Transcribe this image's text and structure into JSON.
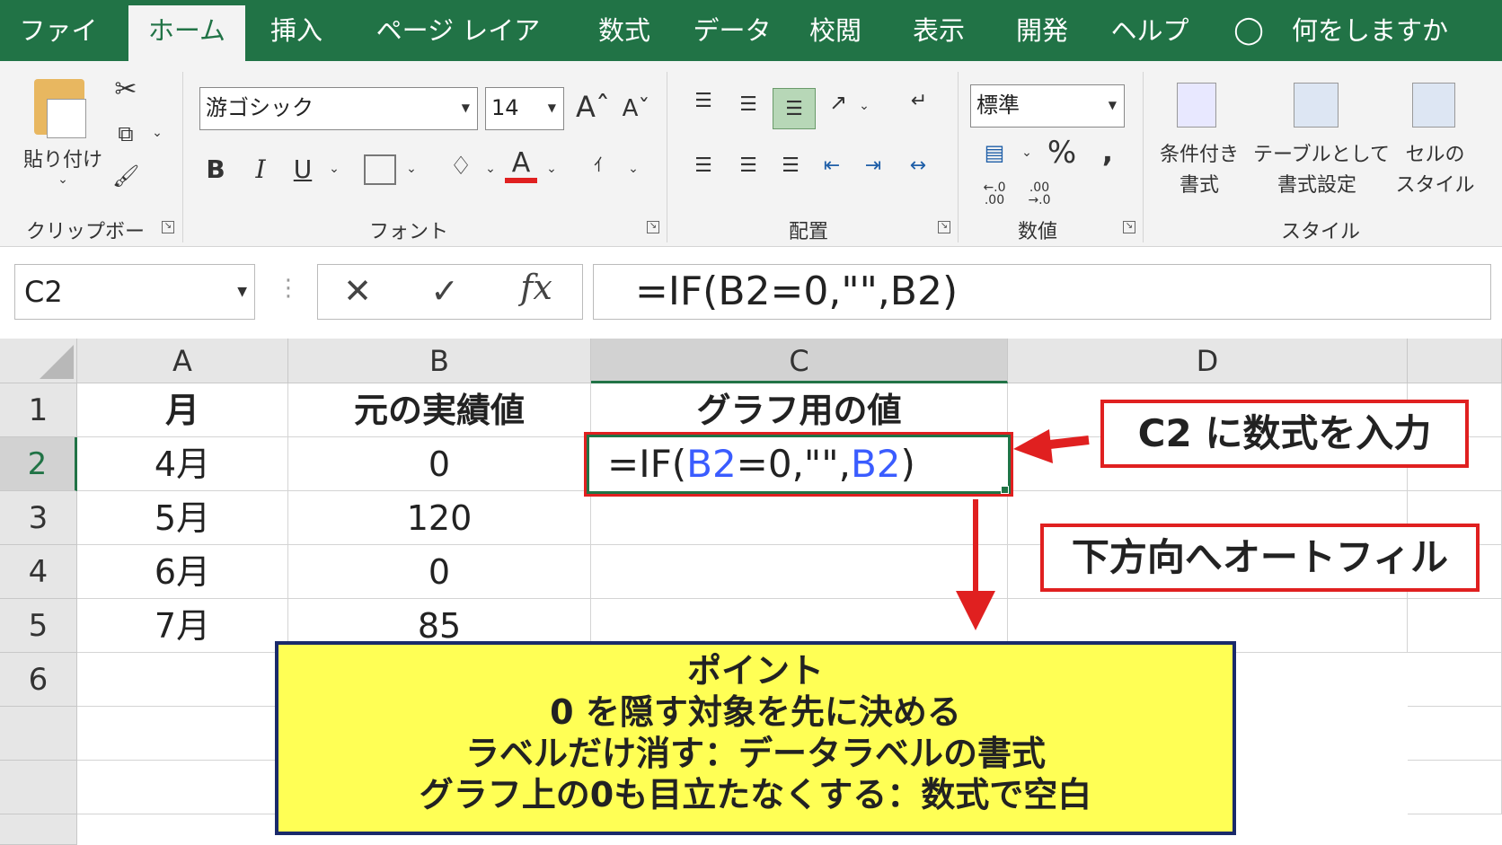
{
  "tabs": [
    "ファイル",
    "ホーム",
    "挿入",
    "ページ レイアウト",
    "数式",
    "データ",
    "校閲",
    "表示",
    "開発",
    "ヘルプ"
  ],
  "tell_me": "何をしますか",
  "clipboard": {
    "paste_label": "貼り付け",
    "group_label": "クリップボード"
  },
  "font": {
    "family": "游ゴシック",
    "size": "14",
    "group_label": "フォント",
    "bold": "B",
    "italic": "I",
    "underline": "U",
    "color_glyph": "A"
  },
  "alignment": {
    "group_label": "配置"
  },
  "number": {
    "format": "標準",
    "group_label": "数値",
    "percent": "%",
    "comma": ","
  },
  "styles": {
    "conditional": "条件付き\n書式",
    "table": "テーブルとして\n書式設定",
    "cell": "セルの\nスタイル",
    "group_label": "スタイル"
  },
  "formula_bar": {
    "name_box": "C2",
    "fx": "fx",
    "formula": "=IF(B2=0,\"\",B2)"
  },
  "columns": [
    "A",
    "B",
    "C",
    "D"
  ],
  "rows": [
    "1",
    "2",
    "3",
    "4",
    "5",
    "6"
  ],
  "cells": {
    "a1": "月",
    "b1": "元の実績値",
    "c1": "グラフ用の値",
    "a2": "4月",
    "b2": "0",
    "a3": "5月",
    "b3": "120",
    "a4": "6月",
    "b4": "0",
    "a5": "7月",
    "b5": "85"
  },
  "c2_formula": {
    "p1": "=IF(",
    "p2": "B2",
    "p3": "=0,\"\",",
    "p4": "B2",
    "p5": ")"
  },
  "callout_input": "C2 に数式を入力",
  "callout_fill": "下方向へオートフィル",
  "point": {
    "title": "ポイント",
    "line1": "0 を隠す対象を先に決める",
    "line2": "ラベルだけ消す：データラベルの書式",
    "line3": "グラフ上の0も目立たなくする：数式で空白"
  },
  "colors": {
    "excel_green": "#217346",
    "ref_blue": "#3a5cff",
    "callout_red": "#e02020",
    "point_yellow": "#ffff55"
  }
}
